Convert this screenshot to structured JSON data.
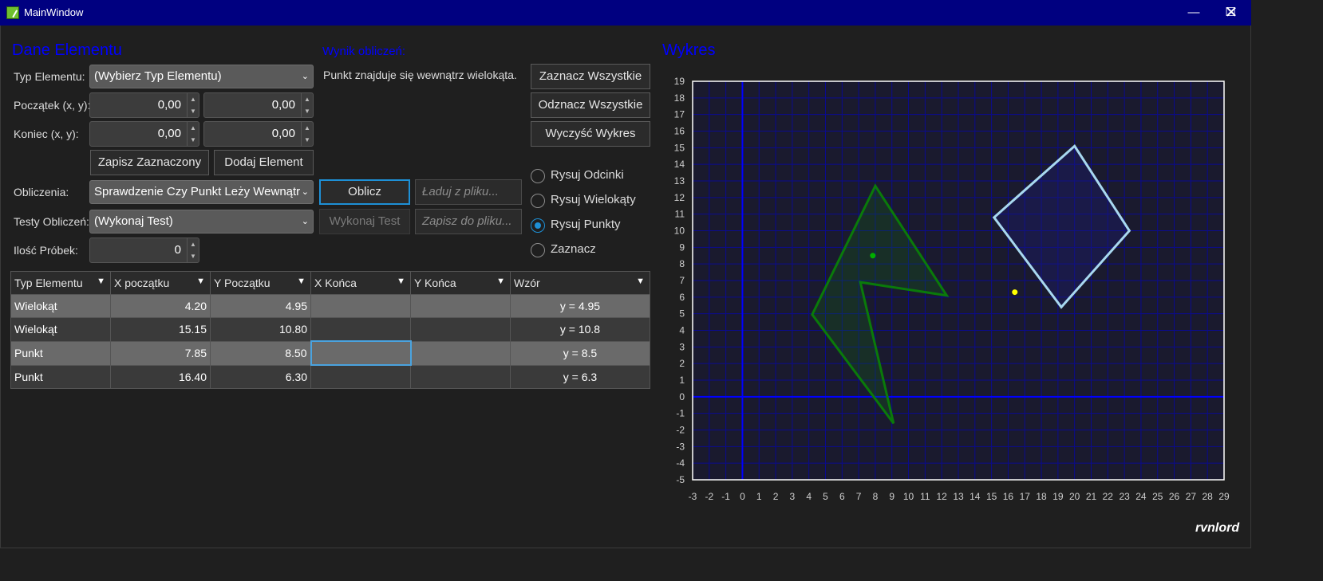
{
  "window": {
    "title": "MainWindow"
  },
  "left": {
    "section_title": "Dane Elementu",
    "type_label": "Typ Elementu:",
    "type_value": "(Wybierz Typ Elementu)",
    "start_label": "Początek (x, y):",
    "start_x": "0,00",
    "start_y": "0,00",
    "end_label": "Koniec (x, y):",
    "end_x": "0,00",
    "end_y": "0,00",
    "save_selected": "Zapisz Zaznaczony",
    "add_element": "Dodaj Element",
    "calc_label": "Obliczenia:",
    "calc_value": "Sprawdzenie Czy Punkt Leży Wewnątr",
    "tests_label": "Testy Obliczeń:",
    "tests_value": "(Wykonaj Test)",
    "samples_label": "Ilość Próbek:",
    "samples_value": "0"
  },
  "middle": {
    "result_title": "Wynik obliczeń:",
    "result_text": "Punkt znajduje się wewnątrz wielokąta.",
    "compute": "Oblicz",
    "run_test": "Wykonaj Test",
    "load_placeholder": "Ładuj z pliku...",
    "save_placeholder": "Zapisz do pliku..."
  },
  "actions": {
    "select_all": "Zaznacz Wszystkie",
    "deselect_all": "Odznacz Wszystkie",
    "clear_chart": "Wyczyść Wykres"
  },
  "modes": {
    "draw_segments": "Rysuj Odcinki",
    "draw_polygons": "Rysuj Wielokąty",
    "draw_points": "Rysuj Punkty",
    "select": "Zaznacz",
    "selected": "draw_points"
  },
  "table": {
    "headers": [
      "Typ Elementu",
      "X początku",
      "Y Początku",
      "X Końca",
      "Y Końca",
      "Wzór"
    ],
    "rows": [
      [
        "Wielokąt",
        "4.20",
        "4.95",
        "",
        "",
        "y = 4.95"
      ],
      [
        "Wielokąt",
        "15.15",
        "10.80",
        "",
        "",
        "y = 10.8"
      ],
      [
        "Punkt",
        "7.85",
        "8.50",
        "",
        "",
        "y = 8.5"
      ],
      [
        "Punkt",
        "16.40",
        "6.30",
        "",
        "",
        "y = 6.3"
      ]
    ]
  },
  "chart_title": "Wykres",
  "chart_data": {
    "type": "scatter",
    "xlim": [
      -3,
      29
    ],
    "ylim": [
      -5,
      19
    ],
    "x_ticks": [
      -3,
      -2,
      -1,
      0,
      1,
      2,
      3,
      4,
      5,
      6,
      7,
      8,
      9,
      10,
      11,
      12,
      13,
      14,
      15,
      16,
      17,
      18,
      19,
      20,
      21,
      22,
      23,
      24,
      25,
      26,
      27,
      28,
      29
    ],
    "y_ticks": [
      19,
      18,
      17,
      16,
      15,
      14,
      13,
      12,
      11,
      10,
      9,
      8,
      7,
      6,
      5,
      4,
      3,
      2,
      1,
      0,
      -1,
      -2,
      -3,
      -4,
      -5
    ],
    "grid": true,
    "polygons": [
      {
        "color": "#0a7a0a",
        "fill": "rgba(20,110,20,0.25)",
        "points": [
          [
            4.2,
            4.95
          ],
          [
            8,
            12.7
          ],
          [
            12.3,
            6.1
          ],
          [
            7.1,
            6.9
          ],
          [
            9.1,
            -1.6
          ]
        ]
      },
      {
        "color": "#a8d8f0",
        "fill": "rgba(30,30,120,0.35)",
        "points": [
          [
            15.15,
            10.8
          ],
          [
            20,
            15.1
          ],
          [
            23.3,
            10
          ],
          [
            19.2,
            5.4
          ]
        ]
      }
    ],
    "points": [
      {
        "x": 7.85,
        "y": 8.5,
        "color": "#00b000"
      },
      {
        "x": 16.4,
        "y": 6.3,
        "color": "#ffff00"
      }
    ],
    "colors": {
      "plot_bg": "#1a1a2e",
      "grid": "#0a0a90",
      "axis": "#0000ff",
      "frame": "#ffffff"
    }
  },
  "signature": "rvnlord"
}
